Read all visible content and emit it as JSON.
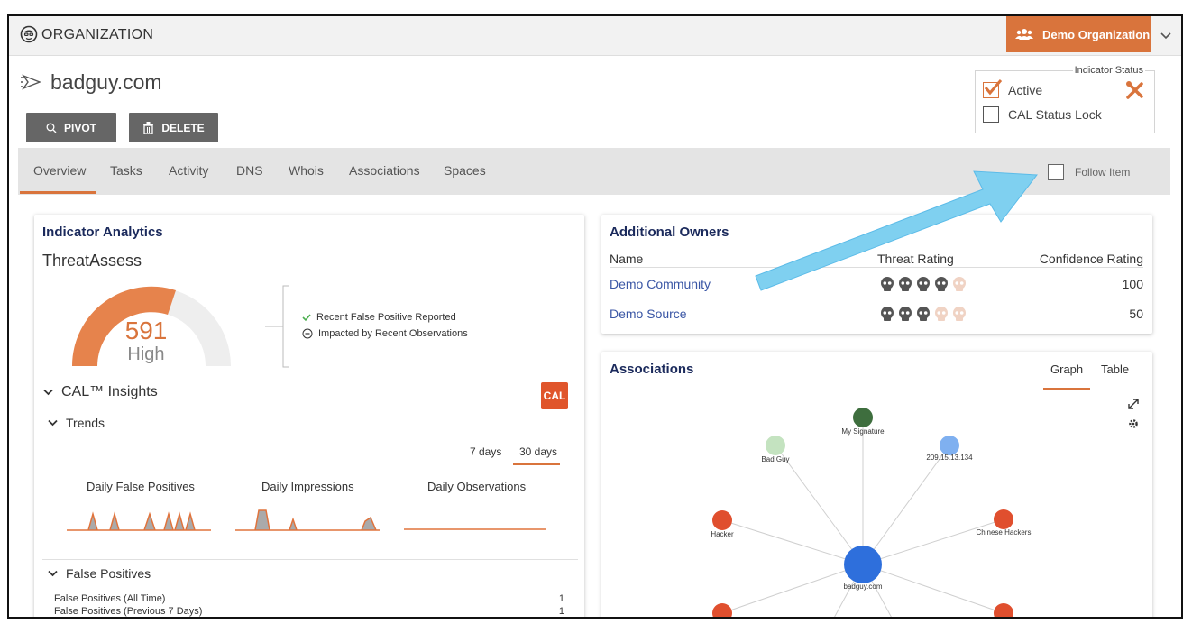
{
  "header": {
    "section_label": "ORGANIZATION",
    "org_button_label": "Demo Organization"
  },
  "indicator": {
    "title": "badguy.com"
  },
  "toolbar": {
    "pivot_label": "PIVOT",
    "delete_label": "DELETE"
  },
  "indicator_status": {
    "legend": "Indicator Status",
    "active_label": "Active",
    "active_checked": true,
    "lock_label": "CAL Status Lock",
    "lock_checked": false
  },
  "tabs": [
    {
      "label": "Overview",
      "active": true
    },
    {
      "label": "Tasks"
    },
    {
      "label": "Activity"
    },
    {
      "label": "DNS"
    },
    {
      "label": "Whois"
    },
    {
      "label": "Associations"
    },
    {
      "label": "Spaces"
    }
  ],
  "follow_item": {
    "label": "Follow Item",
    "checked": false
  },
  "analytics": {
    "title": "Indicator Analytics",
    "threatassess_title": "ThreatAssess",
    "score": "591",
    "score_label": "High",
    "score_fraction": 0.59,
    "reasons": [
      {
        "label": "Recent False Positive Reported",
        "icon": "check-icon"
      },
      {
        "label": "Impacted by Recent Observations",
        "icon": "minus-circle-icon"
      }
    ],
    "cal_insights_label": "CAL™ Insights",
    "cal_badge": "CAL",
    "trends_label": "Trends",
    "range_options": [
      "7 days",
      "30 days"
    ],
    "range_selected": "30 days",
    "sparklines": [
      {
        "label": "Daily False Positives"
      },
      {
        "label": "Daily Impressions"
      },
      {
        "label": "Daily Observations"
      }
    ],
    "false_positives_label": "False Positives",
    "false_positive_rows": [
      {
        "label": "False Positives (All Time)",
        "value": "1"
      },
      {
        "label": "False Positives (Previous 7 Days)",
        "value": "1"
      }
    ]
  },
  "owners": {
    "title": "Additional Owners",
    "columns": [
      "Name",
      "Threat Rating",
      "Confidence Rating"
    ],
    "rows": [
      {
        "name": "Demo Community",
        "threat_rating": 4,
        "threat_max": 5,
        "confidence": "100"
      },
      {
        "name": "Demo Source",
        "threat_rating": 3,
        "threat_max": 5,
        "confidence": "50"
      }
    ]
  },
  "associations": {
    "title": "Associations",
    "view_tabs": [
      "Graph",
      "Table"
    ],
    "selected_view": "Graph",
    "nodes": [
      {
        "label": "badguy.com",
        "color": "#2e6fdc",
        "center": true
      },
      {
        "label": "My Signature",
        "color": "#3e6e3e"
      },
      {
        "label": "Bad Guy",
        "color": "#c4e3c0"
      },
      {
        "label": "209.15.13.134",
        "color": "#7fb0f0"
      },
      {
        "label": "Hacker",
        "color": "#e04f2e"
      },
      {
        "label": "Chinese Hackers",
        "color": "#e04f2e"
      }
    ]
  },
  "colors": {
    "accent": "#d9743c",
    "navy": "#1b2a5c",
    "link": "#3a56a5",
    "arrow": "#7fd0f0"
  }
}
